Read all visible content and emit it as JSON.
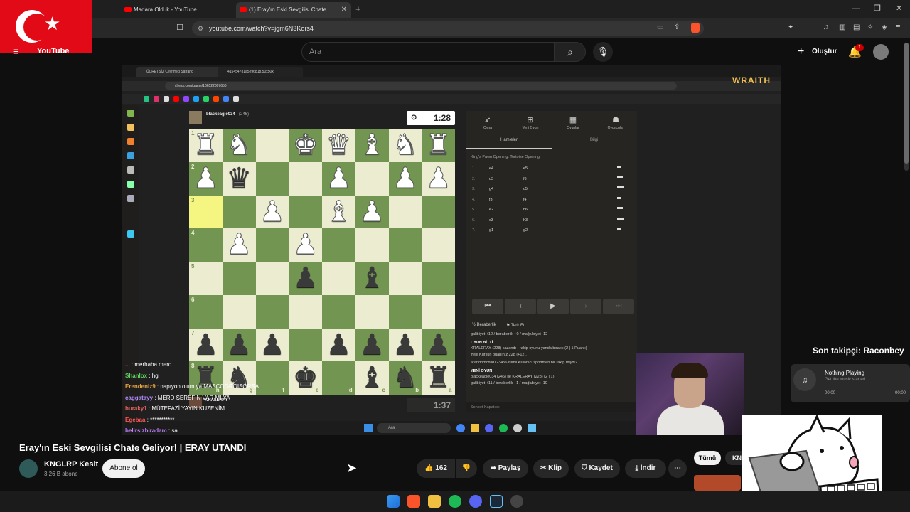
{
  "browser": {
    "tabs": [
      {
        "label": "Madara Olduk - YouTube"
      },
      {
        "label": "(1) Eray'ın Eski Sevgilisi Chate"
      }
    ],
    "url": "youtube.com/watch?v=jgm6N3Kors4"
  },
  "youtube": {
    "logo": "YouTube",
    "search_placeholder": "Ara",
    "create_label": "Oluştur",
    "notification_count": "1",
    "video_title": "Eray'ın Eski Sevgilisi Chate Geliyor! | ERAY UTANDI",
    "channel_name": "KNGLRP Kesit",
    "subscribers": "3,26 B abone",
    "subscribe_label": "Abone ol",
    "like_count": "162",
    "share_label": "Paylaş",
    "clip_label": "Klip",
    "save_label": "Kaydet",
    "download_label": "İndir",
    "chip_all": "Tümü",
    "chip_second": "KNG"
  },
  "stream": {
    "overlay_brand": "WRAITH",
    "inner_tab_1": "ÜCRETSİZ Çevrimiçi Satranç",
    "inner_tab_2": "415454781a5e96818.50x50x",
    "inner_url": "chess.com/game/166522807650",
    "inner_search": "Ara",
    "top_player": "blackeagle034",
    "top_rating": "(246)",
    "top_clock": "1:28",
    "bottom_player": "KRALERAY",
    "bottom_clock": "1:37",
    "panel_tabs": [
      "Oyna",
      "Yeni Oyun",
      "Oyunlar",
      "Oyuncular"
    ],
    "sub_tab_moves": "Hamleler",
    "sub_tab_info": "Bilgi",
    "opening": "King's Pawn Opening: Tortoise Opening",
    "moves": [
      {
        "n": "1.",
        "w": "e4",
        "b": "e5"
      },
      {
        "n": "2.",
        "w": "d3",
        "b": "f6"
      },
      {
        "n": "3.",
        "w": "g4",
        "b": "c5"
      },
      {
        "n": "4.",
        "w": "f3",
        "b": "f4"
      },
      {
        "n": "5.",
        "w": "e2",
        "b": "h6"
      },
      {
        "n": "6.",
        "w": "c3",
        "b": "h3"
      },
      {
        "n": "7.",
        "w": "g1",
        "b": "g2"
      }
    ],
    "draw_label": "Beraberlik",
    "resign_label": "Terk Et",
    "log": [
      "galibiyet +12 / beraberlik +0 / mağlubiyet -12",
      "OYUN BİTTİ",
      "KRALERAY (228) kazandı - rakip oyunu yanda bıraktı (2 | 1 Puanlı)",
      "Yeni Kurşun puanınız 228 (+12).",
      "arandomchild123456 isimli kullanıcı sportmen bir rakip miydi?",
      "YENİ OYUN",
      "blackeagle034 (246) ile KRALERAY (228) (2 | 1)",
      "galibiyet +11 / beraberlik +1 / mağlubiyet -10"
    ],
    "chat_closed": "Sohbet Kapatıldı",
    "chat": [
      {
        "user": "...",
        "msg": ": merhaba merd",
        "color": "#e05c5c"
      },
      {
        "user": "Shanlox",
        "msg": ": hg",
        "color": "#5fd35f"
      },
      {
        "user": "Erendeniz9",
        "msg": ": napıyon olum ya MASCOGROISORSA",
        "color": "#e0a040"
      },
      {
        "user": "caggatayy",
        "msg": ": MERD SEREFIN VAR MI YA",
        "color": "#b48cff"
      },
      {
        "user": "buraky1",
        "msg": ": MÜTEFAZİ YAYIN KUZENİM",
        "color": "#e06060"
      },
      {
        "user": "Egebaa",
        "msg": ": ***********",
        "color": "#ff5555"
      },
      {
        "user": "belirsizbiradam",
        "msg": ": sa",
        "color": "#c080ff"
      }
    ],
    "follower_text": "Son takipçi: Raconbey",
    "now_playing_title": "Nothing Playing",
    "now_playing_sub": "Get the music started",
    "np_time_left": "00:00",
    "np_time_right": "00:00"
  },
  "board": {
    "rank_labels": [
      "1",
      "2",
      "3",
      "4",
      "5",
      "6",
      "7",
      "8"
    ],
    "file_labels": [
      "h",
      "g",
      "f",
      "e",
      "d",
      "c",
      "b",
      "a"
    ]
  }
}
